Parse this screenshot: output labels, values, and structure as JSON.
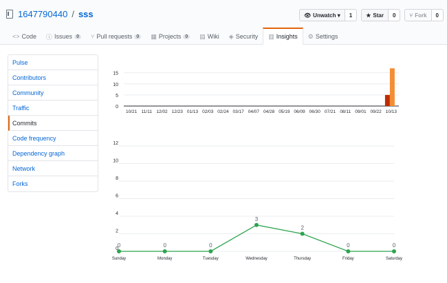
{
  "repo": {
    "owner": "1647790440",
    "separator": "/",
    "name": "sss"
  },
  "actions": {
    "watch_label": "Unwatch ▾",
    "watch_count": "1",
    "star_label": "Star",
    "star_count": "0",
    "fork_label": "Fork",
    "fork_count": "0"
  },
  "tabs": [
    {
      "label": "Code",
      "icon": "<>"
    },
    {
      "label": "Issues",
      "icon": "ⓘ",
      "badge": "0"
    },
    {
      "label": "Pull requests",
      "icon": "⑂",
      "badge": "0"
    },
    {
      "label": "Projects",
      "icon": "▦",
      "badge": "0"
    },
    {
      "label": "Wiki",
      "icon": "▤"
    },
    {
      "label": "Security",
      "icon": "◈"
    },
    {
      "label": "Insights",
      "icon": "▥"
    },
    {
      "label": "Settings",
      "icon": "⚙"
    }
  ],
  "sidebar": {
    "items": [
      "Pulse",
      "Contributors",
      "Community",
      "Traffic",
      "Commits",
      "Code frequency",
      "Dependency graph",
      "Network",
      "Forks"
    ],
    "active": "Commits"
  },
  "colors": {
    "accent": "#e36209",
    "line": "#2ea44f",
    "bar_dark": "#bd2c00",
    "bar_orange": "#f48d33",
    "link": "#0366d6"
  },
  "chart_data": [
    {
      "type": "bar",
      "categories": [
        "10/21",
        "11/11",
        "12/02",
        "12/23",
        "01/13",
        "02/03",
        "02/24",
        "03/17",
        "04/07",
        "04/28",
        "05/19",
        "06/09",
        "06/30",
        "07/21",
        "08/11",
        "09/01",
        "09/22",
        "10/13"
      ],
      "series": [
        {
          "values": [
            0,
            0,
            0,
            0,
            0,
            0,
            0,
            0,
            0,
            0,
            0,
            0,
            0,
            0,
            0,
            0,
            0,
            5
          ]
        },
        {
          "values": [
            0,
            0,
            0,
            0,
            0,
            0,
            0,
            0,
            0,
            0,
            0,
            0,
            0,
            0,
            0,
            0,
            0,
            17
          ]
        }
      ],
      "yticks": [
        "15",
        "10",
        "5",
        "0"
      ],
      "ylim": [
        0,
        18
      ]
    },
    {
      "type": "line",
      "categories": [
        "Sunday",
        "Monday",
        "Tuesday",
        "Wednesday",
        "Thursday",
        "Friday",
        "Saturday"
      ],
      "values": [
        0,
        0,
        0,
        3,
        2,
        0,
        0
      ],
      "labels": [
        "0",
        "0",
        "0",
        "3",
        "2",
        "0",
        "0"
      ],
      "yticks": [
        "12",
        "10",
        "8",
        "6",
        "4",
        "2",
        "0"
      ],
      "ylim": [
        0,
        12
      ]
    }
  ]
}
